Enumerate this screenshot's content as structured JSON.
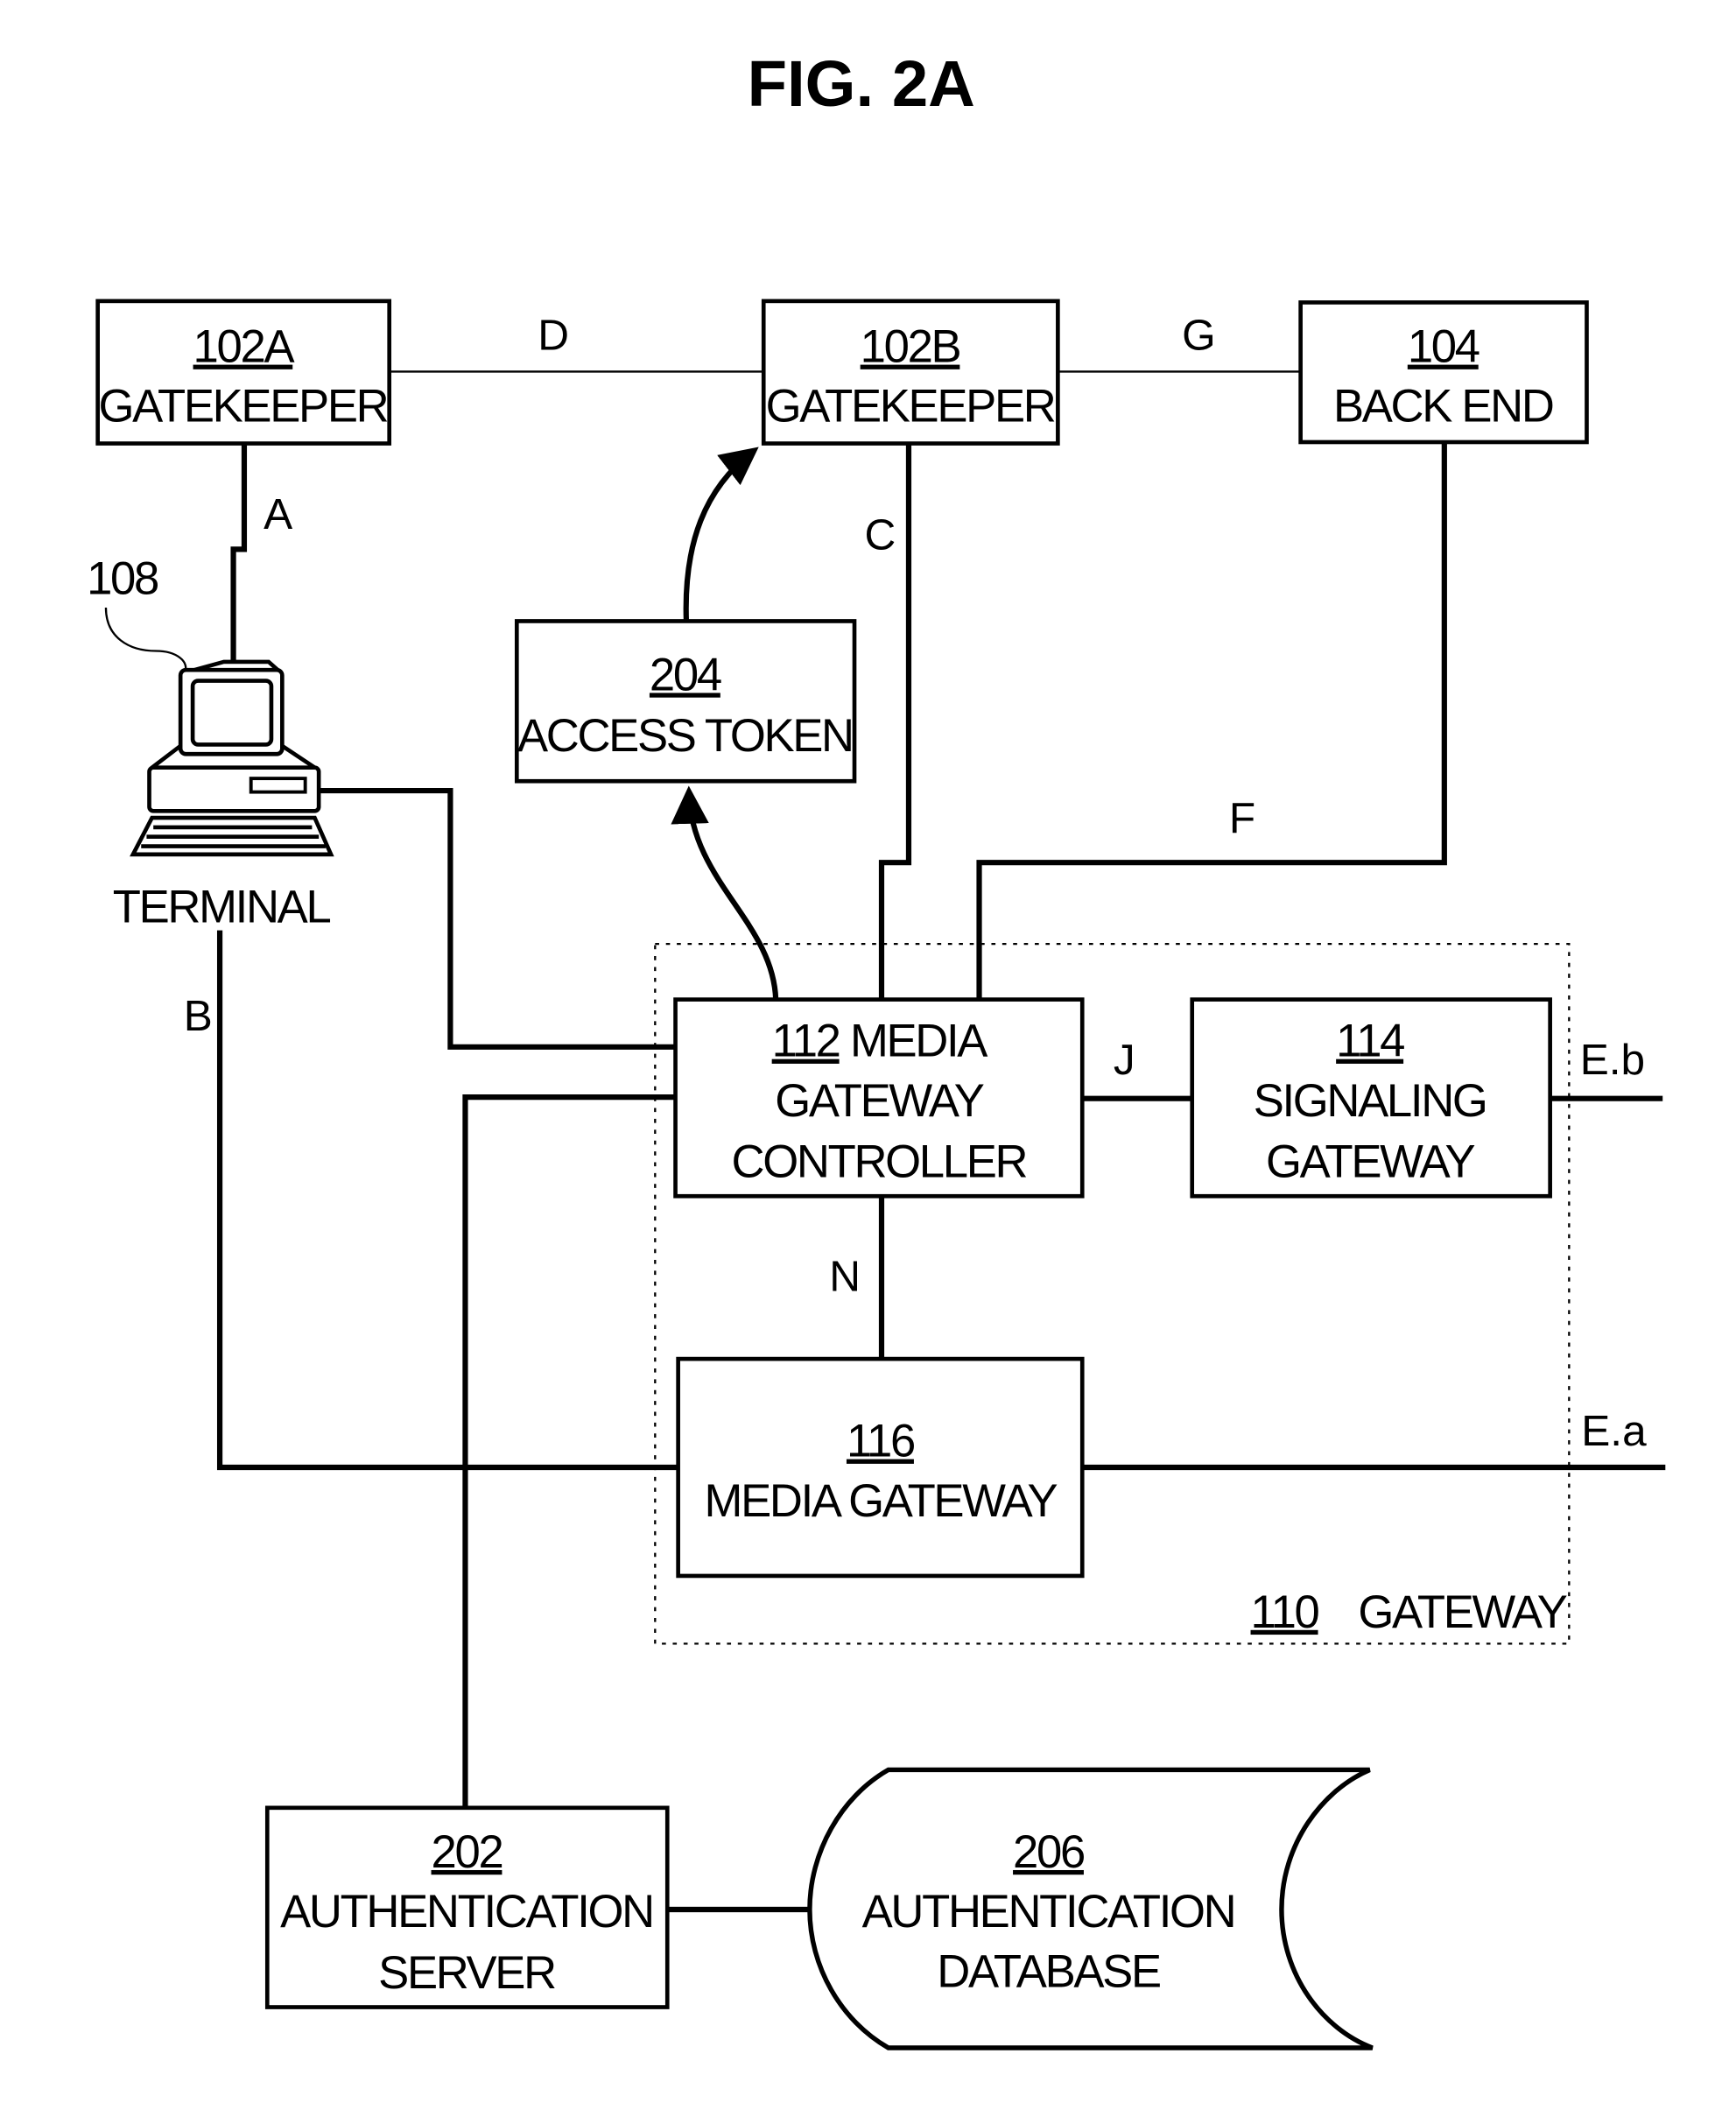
{
  "figure": {
    "title": "FIG. 2A"
  },
  "nodes": {
    "gatekeeper_a": {
      "ref": "102A",
      "label": "GATEKEEPER"
    },
    "gatekeeper_b": {
      "ref": "102B",
      "label": "GATEKEEPER"
    },
    "back_end": {
      "ref": "104",
      "label": "BACK END"
    },
    "access_token": {
      "ref": "204",
      "label": "ACCESS TOKEN"
    },
    "terminal": {
      "ref": "108",
      "label": "TERMINAL"
    },
    "media_gateway_controller": {
      "ref": "112",
      "line1": "MEDIA",
      "line2": "GATEWAY",
      "line3": "CONTROLLER"
    },
    "signaling_gateway": {
      "ref": "114",
      "line1": "SIGNALING",
      "line2": "GATEWAY"
    },
    "media_gateway": {
      "ref": "116",
      "label": "MEDIA GATEWAY"
    },
    "gateway": {
      "ref": "110",
      "label": "GATEWAY"
    },
    "auth_server": {
      "ref": "202",
      "line1": "AUTHENTICATION",
      "line2": "SERVER"
    },
    "auth_database": {
      "ref": "206",
      "line1": "AUTHENTICATION",
      "line2": "DATABASE"
    }
  },
  "connections": {
    "A": "A",
    "B": "B",
    "C": "C",
    "D": "D",
    "F": "F",
    "G": "G",
    "J": "J",
    "N": "N",
    "Ea": "E.a",
    "Eb": "E.b"
  }
}
